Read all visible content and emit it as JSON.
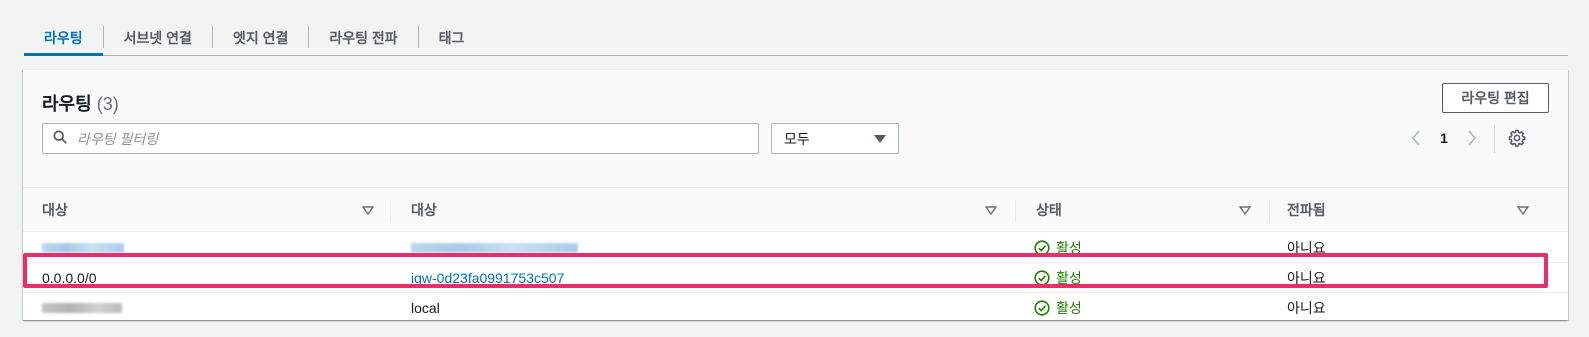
{
  "tabs": [
    {
      "label": "라우팅"
    },
    {
      "label": "서브넷 연결"
    },
    {
      "label": "엣지 연결"
    },
    {
      "label": "라우팅 전파"
    },
    {
      "label": "태그"
    }
  ],
  "panel": {
    "title": "라우팅",
    "count": "(3)",
    "edit_button": "라우팅 편집",
    "search_placeholder": "라우팅 필터링",
    "filter_select": "모두",
    "page": "1"
  },
  "columns": [
    "대상",
    "대상",
    "상태",
    "전파됨"
  ],
  "rows": [
    {
      "destination": "",
      "target": "",
      "status": "활성",
      "propagated": "아니요"
    },
    {
      "destination": "0.0.0.0/0",
      "target": "igw-0d23fa0991753c507",
      "status": "활성",
      "propagated": "아니요"
    },
    {
      "destination": "",
      "target": "local",
      "status": "활성",
      "propagated": "아니요"
    }
  ],
  "colors": {
    "accent": "#0073bb",
    "status_active": "#1d8102",
    "highlight": "#ec2c6b"
  },
  "icons": {
    "search": "search-icon",
    "sort": "sort-caret-icon",
    "status": "check-circle-icon",
    "settings": "gear-icon"
  }
}
